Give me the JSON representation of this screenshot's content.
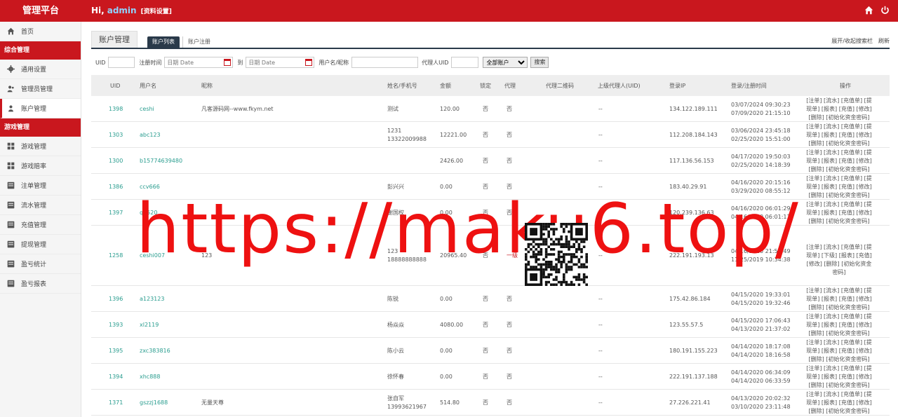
{
  "header": {
    "brand": "管理平台",
    "greeting": "Hi,",
    "username": "admin",
    "profile_link": "[资料设置]",
    "icons": [
      "home-icon",
      "power-icon"
    ]
  },
  "sidebar": {
    "home": "首页",
    "section1": "综合管理",
    "items1": [
      {
        "label": "通用设置",
        "icon": "gear-icon"
      },
      {
        "label": "管理员管理",
        "icon": "users-icon"
      },
      {
        "label": "账户管理",
        "icon": "user-icon"
      }
    ],
    "section2": "游戏管理",
    "items2": [
      {
        "label": "游戏管理",
        "icon": "grid-icon"
      },
      {
        "label": "游戏赔率",
        "icon": "grid-icon"
      },
      {
        "label": "注单管理",
        "icon": "list-icon"
      },
      {
        "label": "流水管理",
        "icon": "list-icon"
      },
      {
        "label": "充值管理",
        "icon": "list-icon"
      },
      {
        "label": "提现管理",
        "icon": "list-icon"
      },
      {
        "label": "盈亏统计",
        "icon": "list-icon"
      },
      {
        "label": "盈亏报表",
        "icon": "list-icon"
      }
    ]
  },
  "tabs": {
    "main": "账户管理",
    "list": "账户列表",
    "register": "账户注册",
    "toggle_search": "展开/收起搜索栏",
    "refresh": "刷新"
  },
  "filter": {
    "uid": "UID",
    "reg_time": "注册时间",
    "date_placeholder": "日期 Date",
    "to": "到",
    "username": "用户名/昵称",
    "agent_uid": "代理人UID",
    "account_type": "全部账户",
    "search": "搜索"
  },
  "table": {
    "headers": [
      "UID",
      "用户名",
      "昵称",
      "姓名/手机号",
      "金额",
      "锁定",
      "代理",
      "代理二维码",
      "上级代理人(UID)",
      "登录IP",
      "登录/注册时间",
      "操作"
    ],
    "rows": [
      {
        "uid": "1398",
        "user": "ceshi",
        "nick": "凡客源码网--www.fkym.net",
        "name": "测试",
        "phone": "",
        "amount": "120.00",
        "locked": "否",
        "agent": "否",
        "parent": "--",
        "ip": "134.122.189.111",
        "t1": "03/07/2024 09:30:23",
        "t2": "07/09/2020 21:15:10",
        "ops": "[注单] [流水] [充值单] [提现单] [报表] [充值] [修改] [删除] [初始化资金密码]"
      },
      {
        "uid": "1303",
        "user": "abc123",
        "nick": "",
        "name": "1231",
        "phone": "13322009988",
        "amount": "12221.00",
        "locked": "否",
        "agent": "否",
        "parent": "--",
        "ip": "112.208.184.143",
        "t1": "03/06/2024 23:45:18",
        "t2": "02/25/2020 15:51:00",
        "ops": "[注单] [流水] [充值单] [提现单] [报表] [充值] [修改] [删除] [初始化资金密码]"
      },
      {
        "uid": "1300",
        "user": "b15774639480",
        "nick": "",
        "name": "",
        "phone": "",
        "amount": "2426.00",
        "locked": "否",
        "agent": "否",
        "parent": "--",
        "ip": "117.136.56.153",
        "t1": "04/17/2020 19:50:03",
        "t2": "02/25/2020 14:18:39",
        "ops": "[注单] [流水] [充值单] [提现单] [报表] [充值] [修改] [删除] [初始化资金密码]"
      },
      {
        "uid": "1386",
        "user": "ccv666",
        "nick": "",
        "name": "彭兴兴",
        "phone": "",
        "amount": "0.00",
        "locked": "否",
        "agent": "否",
        "parent": "--",
        "ip": "183.40.29.91",
        "t1": "04/16/2020 20:15:16",
        "t2": "03/29/2020 08:55:12",
        "ops": "[注单] [流水] [充值单] [提现单] [报表] [充值] [修改] [删除] [初始化资金密码]"
      },
      {
        "uid": "1397",
        "user": "qq520",
        "nick": "",
        "name": "谢国权",
        "phone": "",
        "amount": "0.00",
        "locked": "否",
        "agent": "否",
        "parent": "--",
        "ip": "120.239.136.63",
        "t1": "04/16/2020 06:01:29",
        "t2": "04/16/2020 06:01:11",
        "ops": "[注单] [流水] [充值单] [提现单] [报表] [充值] [修改] [删除] [初始化资金密码]"
      },
      {
        "uid": "1258",
        "user": "ceshi007",
        "nick": "123",
        "name": "123",
        "phone": "18888888888",
        "amount": "20965.40",
        "locked": "否",
        "agent": "一级",
        "parent": "--",
        "ip": "222.191.193.13",
        "t1": "04/16/2020 21:55:49",
        "t2": "11/25/2019 10:34:38",
        "ops": "[注单] [流水] [充值单] [提现单] [下级] [报表] [充值] [修改] [删除] [初始化资金密码]"
      },
      {
        "uid": "1396",
        "user": "a123123",
        "nick": "",
        "name": "陈锐",
        "phone": "",
        "amount": "0.00",
        "locked": "否",
        "agent": "否",
        "parent": "--",
        "ip": "175.42.86.184",
        "t1": "04/15/2020 19:33:01",
        "t2": "04/15/2020 19:32:46",
        "ops": "[注单] [流水] [充值单] [提现单] [报表] [充值] [修改] [删除] [初始化资金密码]"
      },
      {
        "uid": "1393",
        "user": "xl2119",
        "nick": "",
        "name": "杨焱焱",
        "phone": "",
        "amount": "4080.00",
        "locked": "否",
        "agent": "否",
        "parent": "--",
        "ip": "123.55.57.5",
        "t1": "04/15/2020 17:06:43",
        "t2": "04/13/2020 21:37:02",
        "ops": "[注单] [流水] [充值单] [提现单] [报表] [充值] [修改] [删除] [初始化资金密码]"
      },
      {
        "uid": "1395",
        "user": "zxc383816",
        "nick": "",
        "name": "陈小云",
        "phone": "",
        "amount": "0.00",
        "locked": "否",
        "agent": "否",
        "parent": "--",
        "ip": "180.191.155.223",
        "t1": "04/14/2020 18:17:08",
        "t2": "04/14/2020 18:16:58",
        "ops": "[注单] [流水] [充值单] [提现单] [报表] [充值] [修改] [删除] [初始化资金密码]"
      },
      {
        "uid": "1394",
        "user": "xhc888",
        "nick": "",
        "name": "徐怀春",
        "phone": "",
        "amount": "0.00",
        "locked": "否",
        "agent": "否",
        "parent": "--",
        "ip": "222.191.137.188",
        "t1": "04/14/2020 06:34:09",
        "t2": "04/14/2020 06:33:59",
        "ops": "[注单] [流水] [充值单] [提现单] [报表] [充值] [修改] [删除] [初始化资金密码]"
      },
      {
        "uid": "1371",
        "user": "gszzj1688",
        "nick": "无量天尊",
        "name": "张自军",
        "phone": "13993621967",
        "amount": "514.80",
        "locked": "否",
        "agent": "否",
        "parent": "--",
        "ip": "27.226.221.41",
        "t1": "04/13/2020 20:02:32",
        "t2": "03/10/2020 23:11:48",
        "ops": "[注单] [流水] [充值单] [提现单] [报表] [充值] [修改] [删除] [初始化资金密码]"
      }
    ]
  },
  "watermark": "https://maku6.top/",
  "colors": {
    "brand_red": "#c9171e",
    "teal": "#2a9d8f",
    "dark_tab": "#2a3a4a",
    "watermark": "#ee1111"
  }
}
